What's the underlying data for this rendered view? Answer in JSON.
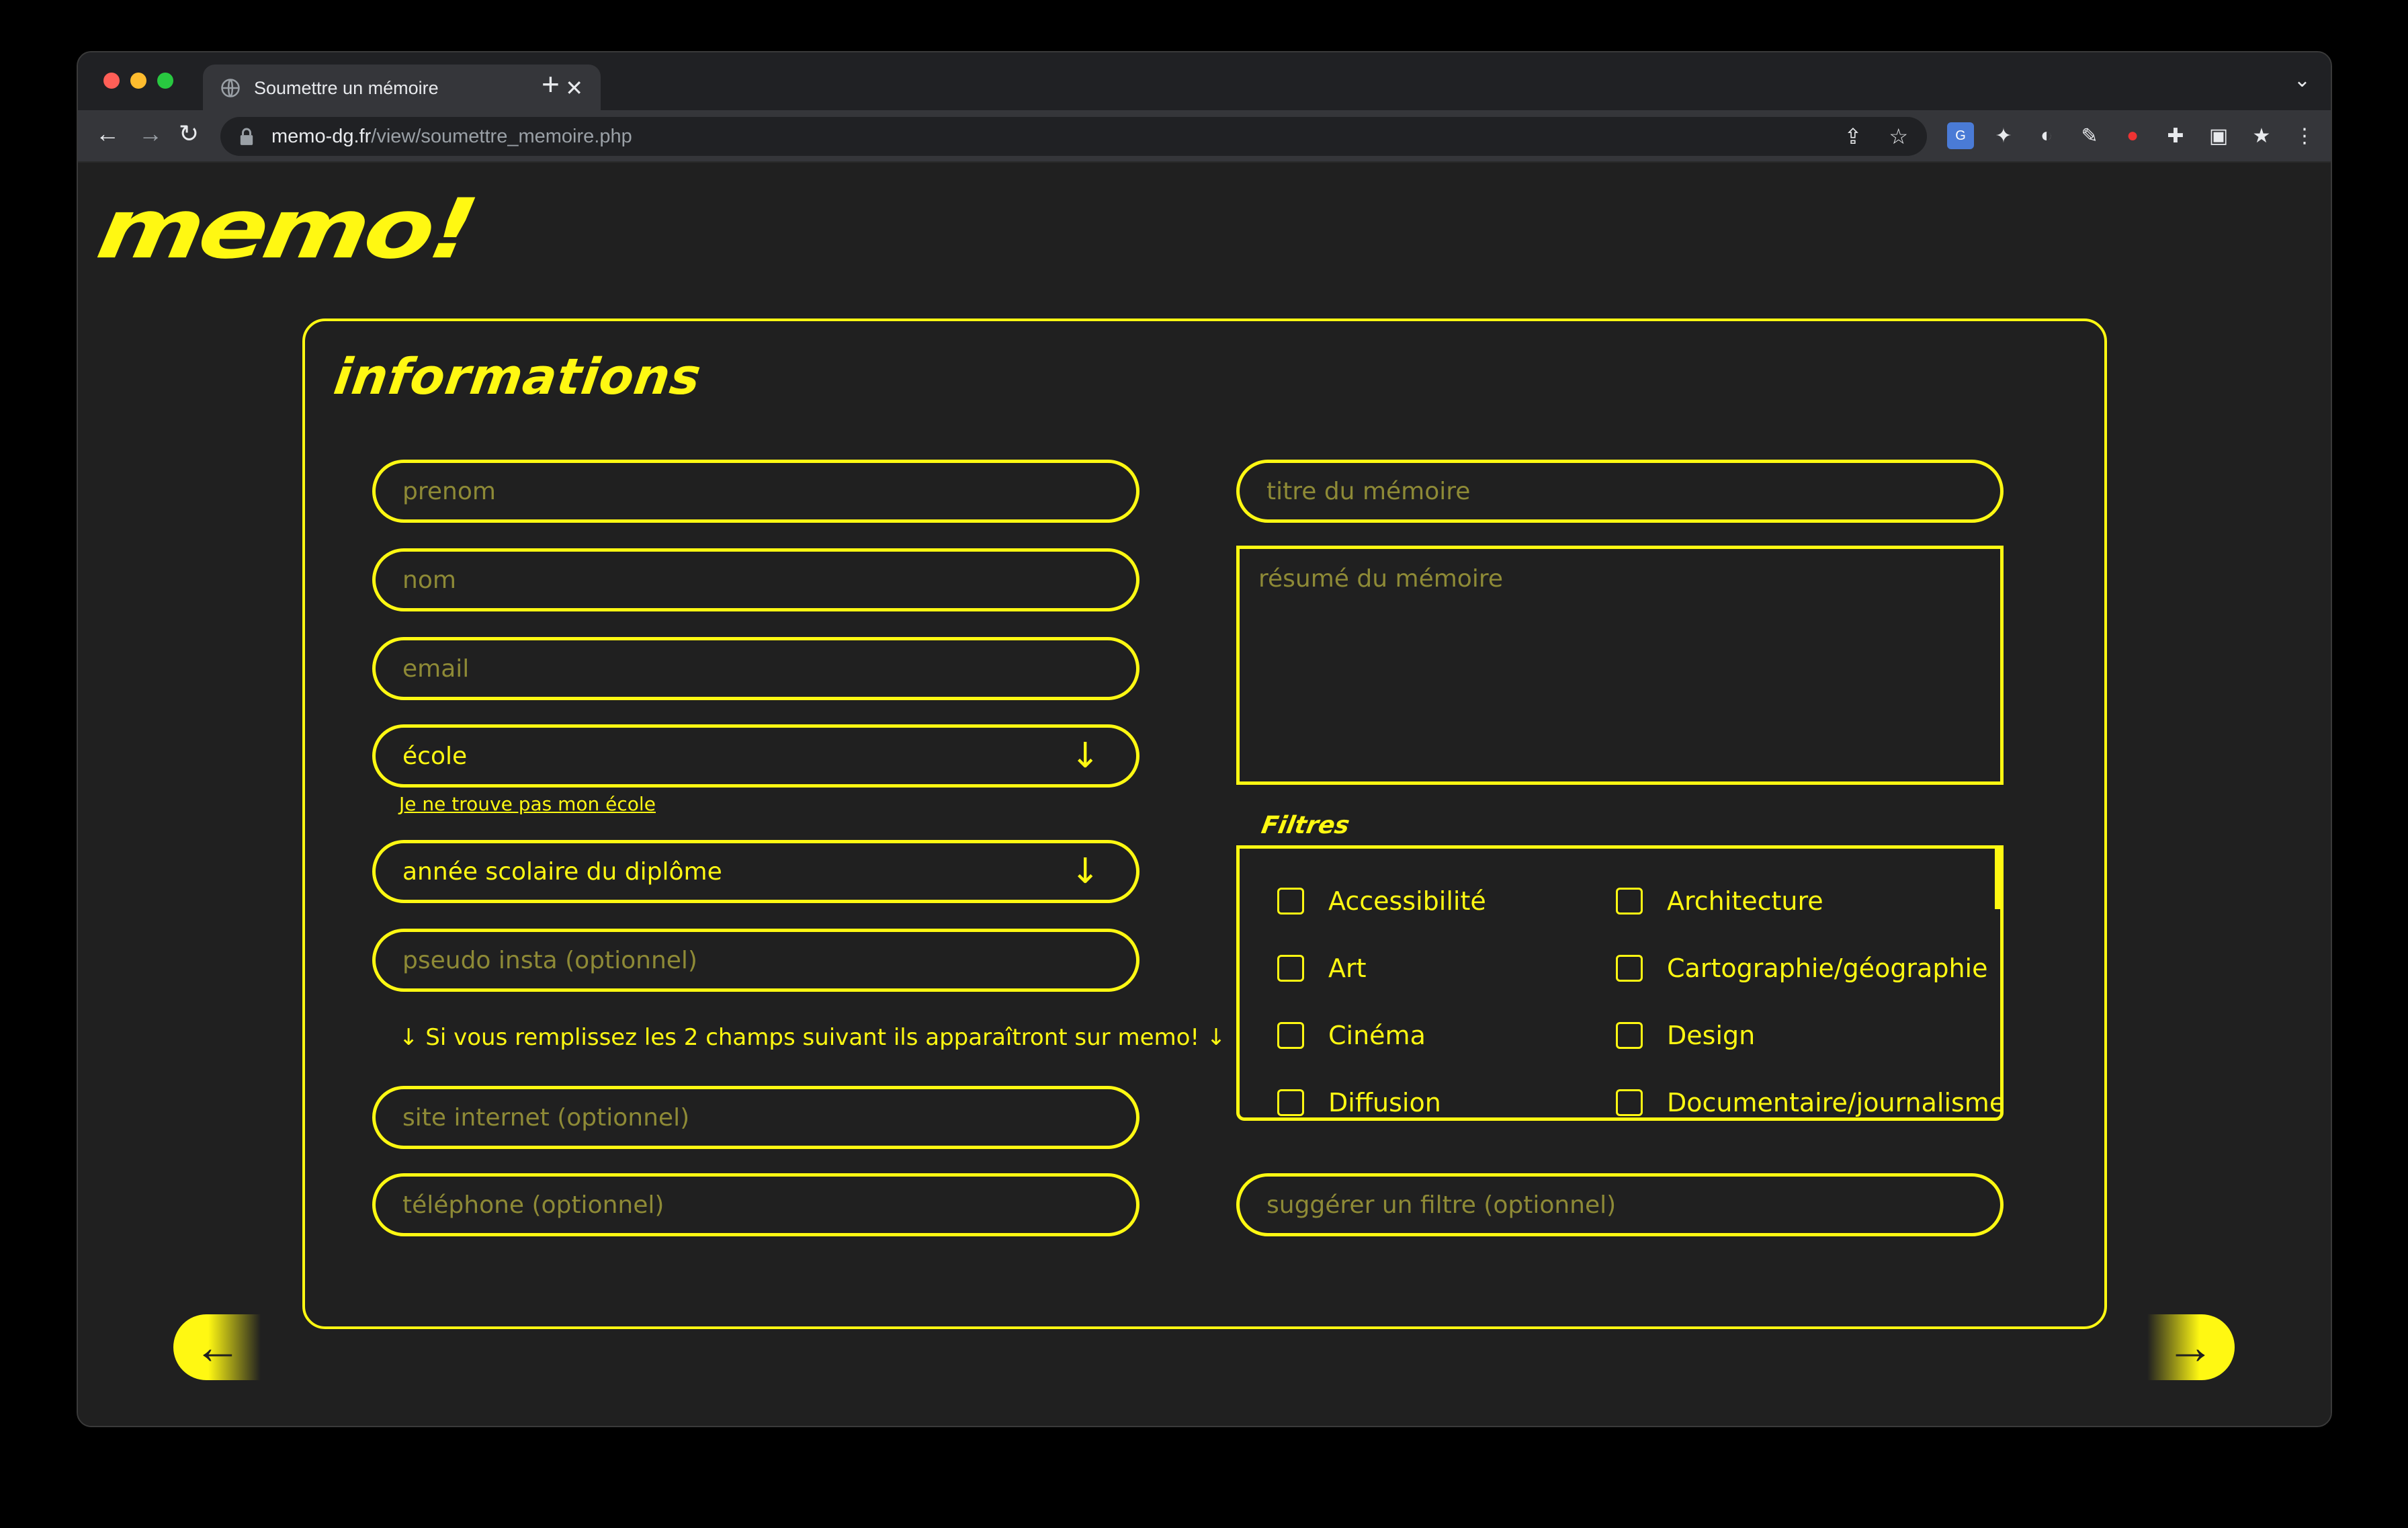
{
  "browser": {
    "tab_title": "Soumettre un mémoire",
    "new_tab": "+",
    "url_host": "memo-dg.fr",
    "url_path": "/view/soumettre_memoire.php"
  },
  "site": {
    "logo": "memo!"
  },
  "form": {
    "heading": "informations",
    "left": {
      "prenom_placeholder": "prenom",
      "nom_placeholder": "nom",
      "email_placeholder": "email",
      "ecole_label": "école",
      "ecole_link": "Je ne trouve pas mon école",
      "annee_label": "année scolaire du diplôme",
      "insta_placeholder": "pseudo insta (optionnel)",
      "note": "↓ Si vous remplissez les 2 champs suivant ils apparaîtront sur memo! ↓",
      "site_placeholder": "site internet (optionnel)",
      "tel_placeholder": "téléphone (optionnel)"
    },
    "right": {
      "titre_placeholder": "titre du mémoire",
      "resume_placeholder": "résumé du mémoire",
      "filters_title": "Filtres",
      "filters": [
        "Accessibilité",
        "Architecture",
        "Art",
        "Cartographie/géographie",
        "Cinéma",
        "Design",
        "Diffusion",
        "Documentaire/journalisme"
      ],
      "suggest_placeholder": "suggérer un filtre (optionnel)"
    },
    "select_arrow": "↓"
  },
  "nav": {
    "prev": "←",
    "next": "→"
  },
  "colors": {
    "accent": "#fff812",
    "background": "#202020",
    "placeholder": "#8e8a36"
  }
}
